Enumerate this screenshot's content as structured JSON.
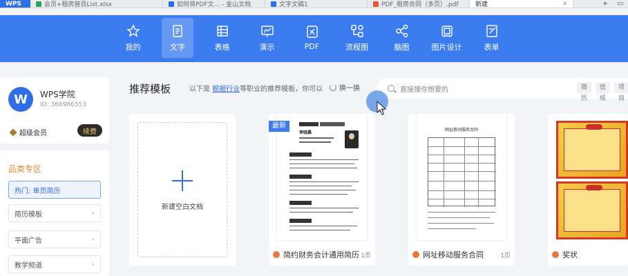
{
  "tabs": [
    {
      "label": "WPS",
      "kind": "home"
    },
    {
      "label": "会员+租房管员List.xlsx",
      "color": "#2aa55c"
    },
    {
      "label": "如何将PDF文... - 金山文档",
      "color": "#2e6ee6"
    },
    {
      "label": "文字文稿1",
      "color": "#2e6ee6"
    },
    {
      "label": "PDF_租房合同（多页）.pdf",
      "color": "#e5533c"
    },
    {
      "label": "新建",
      "active": true
    }
  ],
  "window": {
    "add": "+",
    "restore": "▭"
  },
  "topnav": {
    "items": [
      {
        "label": "我的",
        "icon": "star-icon"
      },
      {
        "label": "文字",
        "icon": "document-icon",
        "active": true
      },
      {
        "label": "表格",
        "icon": "table-icon"
      },
      {
        "label": "演示",
        "icon": "presentation-icon"
      },
      {
        "label": "PDF",
        "icon": "pdf-icon"
      },
      {
        "label": "流程图",
        "icon": "flowchart-icon"
      },
      {
        "label": "脑图",
        "icon": "mindmap-icon"
      },
      {
        "label": "图片设计",
        "icon": "image-design-icon"
      },
      {
        "label": "表单",
        "icon": "form-icon"
      }
    ]
  },
  "profile": {
    "avatar": "W",
    "name": "WPS学院",
    "id": "ID: 368986553",
    "vip": "超级会员",
    "renew": "续费"
  },
  "categories": {
    "title": "品类专区",
    "items": [
      {
        "label": "热门: 单页简历",
        "hot": true
      },
      {
        "label": "简历模板"
      },
      {
        "label": "平面广告"
      },
      {
        "label": "教学频道"
      }
    ]
  },
  "recommend": {
    "title": "推荐模板",
    "sub_prefix": "以下是",
    "sub_link": "根据行业",
    "sub_suffix": "等职业的推荐模板，你可以",
    "swap": "换一换"
  },
  "search": {
    "placeholder": "直接搜你想要的",
    "chips": [
      "简历",
      "信纸",
      "项目"
    ]
  },
  "blank_card": {
    "label": "新建空白文档"
  },
  "templates": [
    {
      "title": "简约财务会计通用简历",
      "pages": "1页",
      "badge": "最新",
      "thumb_name": "李晓晨"
    },
    {
      "title": "网址移动服务合同",
      "pages": "1页",
      "thumb_title": "网址移动服务合同"
    },
    {
      "title": "奖状"
    }
  ],
  "colors": {
    "brand_blue": "#3a7cf0",
    "accent_orange": "#e58a3a"
  }
}
